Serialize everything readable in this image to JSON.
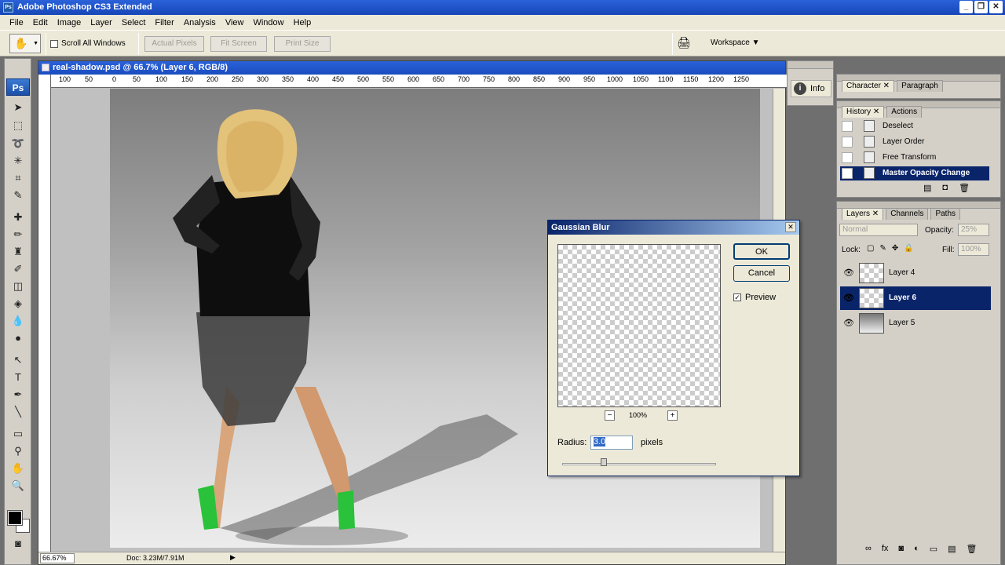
{
  "window": {
    "title": "Adobe Photoshop CS3 Extended",
    "logo": "Ps"
  },
  "menu": [
    "File",
    "Edit",
    "Image",
    "Layer",
    "Select",
    "Filter",
    "Analysis",
    "View",
    "Window",
    "Help"
  ],
  "options": {
    "scroll_all_label": "Scroll All Windows",
    "actual_pixels": "Actual Pixels",
    "fit_screen": "Fit Screen",
    "print_size": "Print Size",
    "workspace": "Workspace"
  },
  "document": {
    "title": "real-shadow.psd @ 66.7% (Layer 6, RGB/8)",
    "zoom": "66.67%",
    "doc_info": "Doc: 3.23M/7.91M",
    "ruler_labels": [
      "100",
      "50",
      "0",
      "50",
      "100",
      "150",
      "200",
      "250",
      "300",
      "350",
      "400",
      "450",
      "500",
      "550",
      "600",
      "650",
      "700",
      "750",
      "800",
      "850",
      "900",
      "950",
      "1000",
      "1050",
      "1100",
      "1150",
      "1200",
      "1250"
    ]
  },
  "info_panel": {
    "label": "Info"
  },
  "character_panel": {
    "tabs": [
      "Character",
      "Paragraph"
    ]
  },
  "history_panel": {
    "tabs": [
      "History",
      "Actions"
    ],
    "items": [
      {
        "label": "Deselect",
        "selected": false
      },
      {
        "label": "Layer Order",
        "selected": false
      },
      {
        "label": "Free Transform",
        "selected": false
      },
      {
        "label": "Master Opacity Change",
        "selected": true
      }
    ]
  },
  "layers_panel": {
    "tabs": [
      "Layers",
      "Channels",
      "Paths"
    ],
    "blend_mode": "Normal",
    "opacity_label": "Opacity:",
    "opacity_value": "25%",
    "lock_label": "Lock:",
    "fill_label": "Fill:",
    "fill_value": "100%",
    "layers": [
      {
        "name": "Layer 4",
        "selected": false
      },
      {
        "name": "Layer 6",
        "selected": true
      },
      {
        "name": "Layer 5",
        "selected": false
      }
    ]
  },
  "gaussian_blur": {
    "title": "Gaussian Blur",
    "ok": "OK",
    "cancel": "Cancel",
    "preview_label": "Preview",
    "preview_checked": true,
    "zoom": "100%",
    "radius_label": "Radius:",
    "radius_value": "3.0",
    "radius_unit": "pixels"
  }
}
